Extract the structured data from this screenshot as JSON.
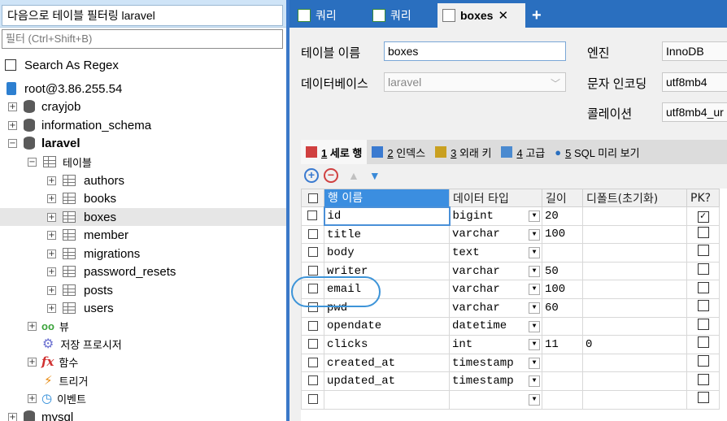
{
  "filter_title": "다음으로 테이블 필터링 laravel",
  "filter_placeholder": "필터 (Ctrl+Shift+B)",
  "search_as_regex": "Search As Regex",
  "tree": {
    "server": "root@3.86.255.54",
    "dbs": [
      "crayjob",
      "information_schema",
      "laravel",
      "mysql"
    ],
    "tables_folder": "테이블",
    "tables": [
      "authors",
      "books",
      "boxes",
      "member",
      "migrations",
      "password_resets",
      "posts",
      "users"
    ],
    "views": "뷰",
    "procedures": "저장 프로시저",
    "functions": "함수",
    "triggers": "트리거",
    "events": "이벤트"
  },
  "tabs": [
    "쿼리",
    "쿼리",
    "boxes"
  ],
  "form": {
    "table_name_label": "테이블 이름",
    "table_name": "boxes",
    "database_label": "데이터베이스",
    "database": "laravel",
    "engine_label": "엔진",
    "engine": "InnoDB",
    "charset_label": "문자 인코딩",
    "charset": "utf8mb4",
    "collation_label": "콜레이션",
    "collation": "utf8mb4_ur"
  },
  "subtabs": [
    {
      "num": "1",
      "label": "세로 행"
    },
    {
      "num": "2",
      "label": "인덱스"
    },
    {
      "num": "3",
      "label": "외래 키"
    },
    {
      "num": "4",
      "label": "고급"
    },
    {
      "num": "5",
      "label": "SQL 미리 보기"
    }
  ],
  "columns_header": [
    "행 이름",
    "데이터 타입",
    "길이",
    "디폴트(초기화)",
    "PK?"
  ],
  "columns": [
    {
      "name": "id",
      "type": "bigint",
      "len": "20",
      "def": "",
      "pk": true
    },
    {
      "name": "title",
      "type": "varchar",
      "len": "100",
      "def": "",
      "pk": false
    },
    {
      "name": "body",
      "type": "text",
      "len": "",
      "def": "",
      "pk": false
    },
    {
      "name": "writer",
      "type": "varchar",
      "len": "50",
      "def": "",
      "pk": false
    },
    {
      "name": "email",
      "type": "varchar",
      "len": "100",
      "def": "",
      "pk": false
    },
    {
      "name": "pwd",
      "type": "varchar",
      "len": "60",
      "def": "",
      "pk": false
    },
    {
      "name": "opendate",
      "type": "datetime",
      "len": "",
      "def": "",
      "pk": false
    },
    {
      "name": "clicks",
      "type": "int",
      "len": "11",
      "def": "0",
      "pk": false
    },
    {
      "name": "created_at",
      "type": "timestamp",
      "len": "",
      "def": "",
      "pk": false
    },
    {
      "name": "updated_at",
      "type": "timestamp",
      "len": "",
      "def": "",
      "pk": false
    },
    {
      "name": "",
      "type": "",
      "len": "",
      "def": "",
      "pk": false
    }
  ],
  "colors": {
    "accent": "#2a6fbf",
    "header_highlight": "#3b8ee0",
    "selection": "#e6e6e6"
  }
}
